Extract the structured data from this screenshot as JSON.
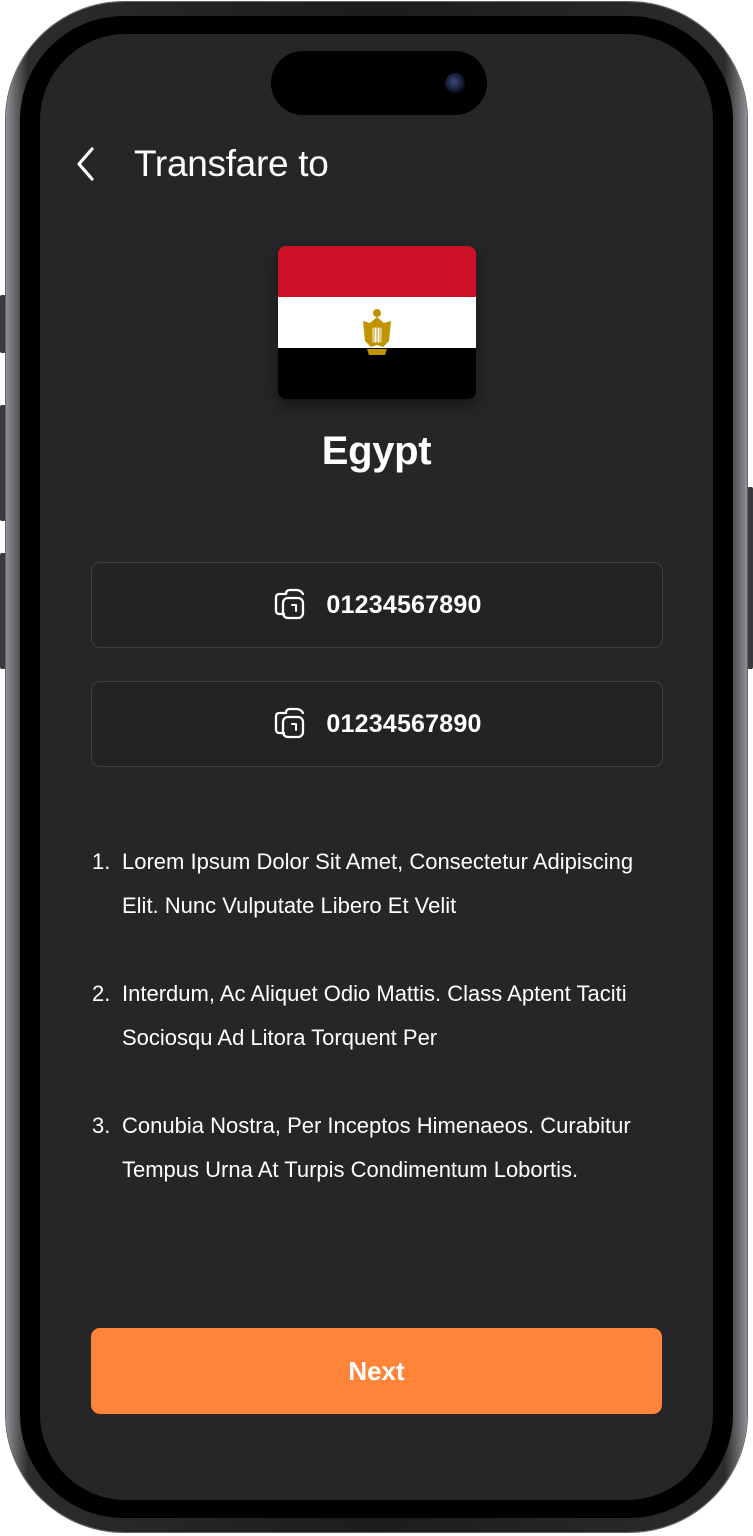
{
  "header": {
    "title": "Transfare to",
    "back_icon": "chevron-left-icon"
  },
  "country": {
    "name": "Egypt",
    "flag_icon": "egypt-flag",
    "flag_colors": {
      "top": "#ce1126",
      "middle": "#ffffff",
      "bottom": "#000000",
      "emblem": "#c09300"
    }
  },
  "accounts": [
    {
      "number": "01234567890",
      "icon": "copy-icon"
    },
    {
      "number": "01234567890",
      "icon": "copy-icon"
    }
  ],
  "steps": [
    {
      "index": "1.",
      "text": "Lorem Ipsum Dolor Sit Amet, Consectetur Adipiscing Elit. Nunc Vulputate Libero Et Velit"
    },
    {
      "index": "2.",
      "text": "Interdum, Ac Aliquet Odio Mattis. Class Aptent Taciti Sociosqu Ad Litora Torquent Per"
    },
    {
      "index": "3.",
      "text": "Conubia Nostra, Per Inceptos Himenaeos. Curabitur Tempus Urna At Turpis Condimentum Lobortis."
    }
  ],
  "actions": {
    "next_label": "Next"
  },
  "colors": {
    "background": "#262628",
    "accent": "#fe8439",
    "text": "#ffffff",
    "border": "#3f3f42"
  }
}
